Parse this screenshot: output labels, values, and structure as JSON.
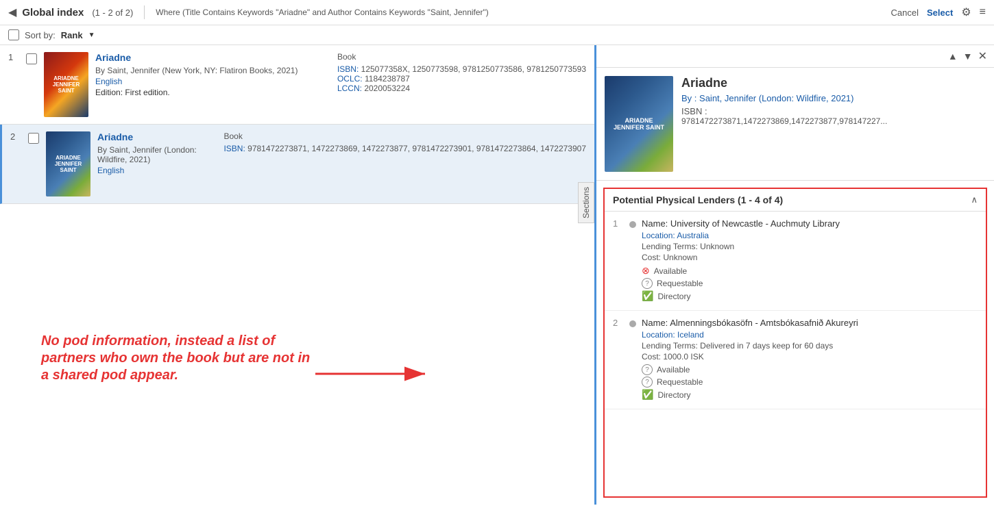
{
  "header": {
    "back_icon": "◀",
    "title": "Global index",
    "count": "(1 - 2 of 2)",
    "filter": "Where (Title Contains Keywords \"Ariadne\" and Author Contains Keywords \"Saint, Jennifer\")",
    "cancel_label": "Cancel",
    "select_label": "Select",
    "gear_icon": "⚙",
    "menu_icon": "≡"
  },
  "toolbar": {
    "sort_by_label": "Sort by:",
    "sort_value": "Rank",
    "caret": "▼"
  },
  "results": [
    {
      "num": 1,
      "title": "Ariadne",
      "author": "By Saint, Jennifer (New York, NY: Flatiron Books, 2021)",
      "language": "English",
      "edition_label": "Edition:",
      "edition": "First edition.",
      "type": "Book",
      "isbn_label": "ISBN:",
      "isbn": "125077358X, 1250773598, 9781250773586, 9781250773593",
      "oclc_label": "OCLC:",
      "oclc": "1184238787",
      "lccn_label": "LCCN:",
      "lccn": "2020053224"
    },
    {
      "num": 2,
      "title": "Ariadne",
      "author": "By Saint, Jennifer (London: Wildfire, 2021)",
      "language": "English",
      "edition_label": "",
      "edition": "",
      "type": "Book",
      "isbn_label": "ISBN:",
      "isbn": "9781472273871, 1472273869, 1472273877, 9781472273901, 9781472273864, 1472273907",
      "oclc_label": "",
      "oclc": "",
      "lccn_label": "",
      "lccn": ""
    }
  ],
  "sections_label": "Sections",
  "annotation": {
    "text": "No pod information, instead a list of partners who own the book but are not in a shared pod appear."
  },
  "right_panel": {
    "nav_up": "▲",
    "nav_down": "▼",
    "close": "✕",
    "book": {
      "title": "Ariadne",
      "by_label": "By :",
      "by": "Saint, Jennifer (London: Wildfire, 2021)",
      "isbn_label": "ISBN :",
      "isbn": "9781472273871,1472273869,1472273877,978147227..."
    },
    "lenders": {
      "title": "Potential Physical Lenders (1 - 4 of 4)",
      "collapse_icon": "∧",
      "items": [
        {
          "num": 1,
          "name_label": "Name:",
          "name": "University of Newcastle - Auchmuty Library",
          "location_label": "Location:",
          "location": "Australia",
          "terms_label": "Lending Terms:",
          "terms": "Unknown",
          "cost_label": "Cost:",
          "cost": "Unknown",
          "available": "Available",
          "available_icon": "x",
          "requestable": "Requestable",
          "requestable_icon": "q",
          "directory": "Directory",
          "directory_icon": "check"
        },
        {
          "num": 2,
          "name_label": "Name:",
          "name": "Almenningsbókasöfn - Amtsbókasafnið Akureyri",
          "location_label": "Location:",
          "location": "Iceland",
          "terms_label": "Lending Terms:",
          "terms": "Delivered in 7 days keep for 60 days",
          "cost_label": "Cost:",
          "cost": "1000.0 ISK",
          "available": "Available",
          "available_icon": "q",
          "requestable": "Requestable",
          "requestable_icon": "q",
          "directory": "Directory",
          "directory_icon": "check"
        }
      ]
    }
  }
}
